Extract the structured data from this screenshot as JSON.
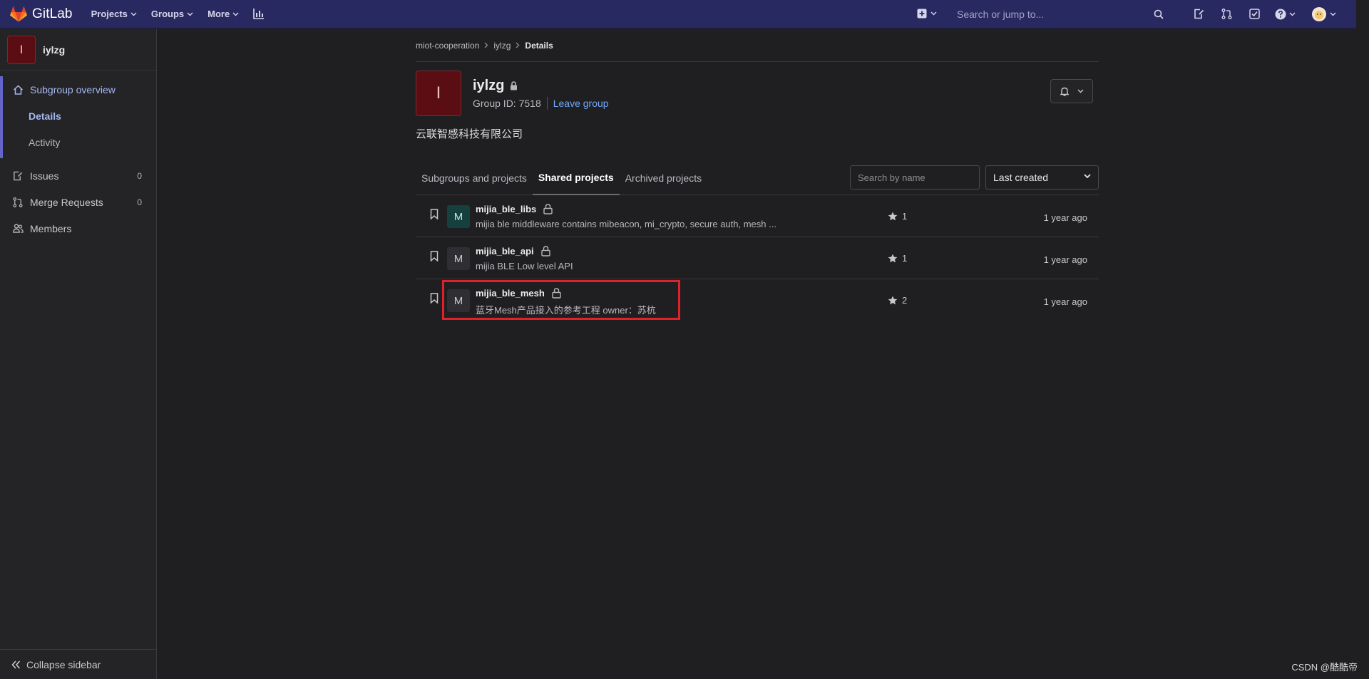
{
  "navbar": {
    "brand": "GitLab",
    "menu": [
      {
        "label": "Projects"
      },
      {
        "label": "Groups"
      },
      {
        "label": "More"
      }
    ],
    "search_placeholder": "Search or jump to..."
  },
  "sidebar": {
    "context_avatar": "I",
    "context_title": "iylzg",
    "overview_label": "Subgroup overview",
    "sub_items": [
      {
        "label": "Details"
      },
      {
        "label": "Activity"
      }
    ],
    "items": [
      {
        "label": "Issues",
        "count": "0"
      },
      {
        "label": "Merge Requests",
        "count": "0"
      },
      {
        "label": "Members"
      }
    ],
    "collapse_label": "Collapse sidebar"
  },
  "breadcrumb": {
    "items": [
      "miot-cooperation",
      "iylzg",
      "Details"
    ]
  },
  "group": {
    "avatar": "I",
    "name": "iylzg",
    "id_text": "Group ID: 7518",
    "leave_label": "Leave group",
    "description": "云联智感科技有限公司"
  },
  "tabs": [
    {
      "label": "Subgroups and projects"
    },
    {
      "label": "Shared projects"
    },
    {
      "label": "Archived projects"
    }
  ],
  "filter": {
    "search_placeholder": "Search by name",
    "sort_value": "Last created"
  },
  "projects": [
    {
      "avatar": "M",
      "name": "mijia_ble_libs",
      "description": "mijia ble middleware contains mibeacon, mi_crypto, secure auth, mesh ...",
      "stars": "1",
      "updated": "1 year ago"
    },
    {
      "avatar": "M",
      "name": "mijia_ble_api",
      "description": "mijia BLE Low level API",
      "stars": "1",
      "updated": "1 year ago"
    },
    {
      "avatar": "M",
      "name": "mijia_ble_mesh",
      "description": "蓝牙Mesh产品接入的参考工程 owner：苏杭",
      "stars": "2",
      "updated": "1 year ago"
    }
  ],
  "watermark": "CSDN @酷酷帝"
}
